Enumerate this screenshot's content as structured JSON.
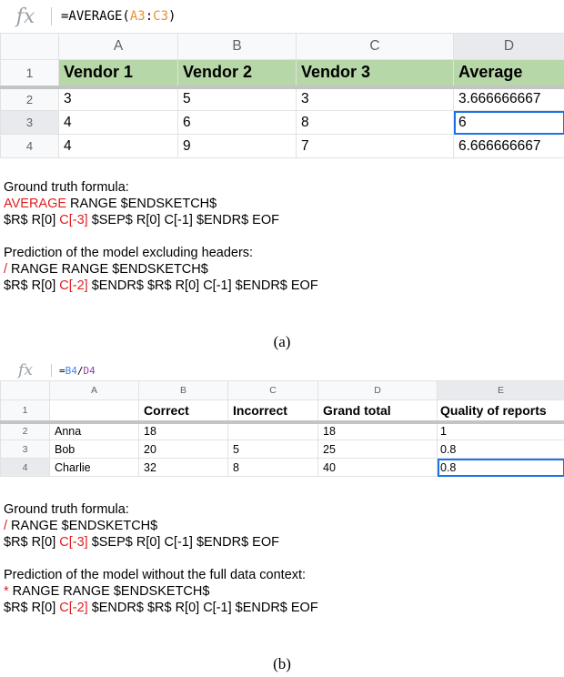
{
  "panel_a": {
    "formula_icon": "fx",
    "formula": {
      "prefix": "=AVERAGE(",
      "ref1": "A3",
      "sep": ":",
      "ref2": "C3",
      "suffix": ")"
    },
    "columns": [
      "A",
      "B",
      "C",
      "D"
    ],
    "rows": [
      {
        "num": "1",
        "cells": [
          "Vendor 1",
          "Vendor 2",
          "Vendor 3",
          "Average"
        ]
      },
      {
        "num": "2",
        "cells": [
          "3",
          "5",
          "3",
          "3.666666667"
        ]
      },
      {
        "num": "3",
        "cells": [
          "4",
          "6",
          "8",
          "6"
        ]
      },
      {
        "num": "4",
        "cells": [
          "4",
          "9",
          "7",
          "6.666666667"
        ]
      }
    ],
    "notes": {
      "gt_label": "Ground truth formula:",
      "gt_line1": {
        "red": "AVERAGE",
        "rest": " RANGE $ENDSKETCH$"
      },
      "gt_line2": {
        "pre": "$R$ R[0] ",
        "red": "C[-3]",
        "post": " $SEP$ R[0] C[-1] $ENDR$ EOF"
      },
      "pred_label": "Prediction of the model excluding headers:",
      "pred_line1": {
        "red": "/",
        "rest": " RANGE RANGE $ENDSKETCH$"
      },
      "pred_line2": {
        "pre": "$R$ R[0] ",
        "red": "C[-2]",
        "post": " $ENDR$ $R$ R[0] C[-1] $ENDR$ EOF"
      }
    },
    "caption": "(a)"
  },
  "panel_b": {
    "formula_icon": "fx",
    "formula": {
      "prefix": "=",
      "ref1": "B4",
      "sep": "/",
      "ref2": "D4",
      "suffix": ""
    },
    "columns": [
      "A",
      "B",
      "C",
      "D",
      "E"
    ],
    "rows": [
      {
        "num": "1",
        "cells": [
          "",
          "Correct",
          "Incorrect",
          "Grand total",
          "Quality of reports"
        ]
      },
      {
        "num": "2",
        "cells": [
          "Anna",
          "18",
          "",
          "18",
          "1"
        ]
      },
      {
        "num": "3",
        "cells": [
          "Bob",
          "20",
          "5",
          "25",
          "0.8"
        ]
      },
      {
        "num": "4",
        "cells": [
          "Charlie",
          "32",
          "8",
          "40",
          "0.8"
        ]
      }
    ],
    "notes": {
      "gt_label": "Ground truth formula:",
      "gt_line1": {
        "red": "/",
        "rest": " RANGE $ENDSKETCH$"
      },
      "gt_line2": {
        "pre": "$R$ R[0] ",
        "red": "C[-3]",
        "post": " $SEP$ R[0] C[-1] $ENDR$ EOF"
      },
      "pred_label": "Prediction of the model without the full data context:",
      "pred_line1": {
        "red": "*",
        "rest": " RANGE RANGE $ENDSKETCH$"
      },
      "pred_line2": {
        "pre": "$R$ R[0] ",
        "red": "C[-2]",
        "post": " $ENDR$ $R$ R[0] C[-1] $ENDR$ EOF"
      }
    },
    "caption": "(b)"
  },
  "colors": {
    "header_green": "#b6d7a8",
    "accent_red": "#e02020",
    "selection_blue": "#1a73e8"
  }
}
